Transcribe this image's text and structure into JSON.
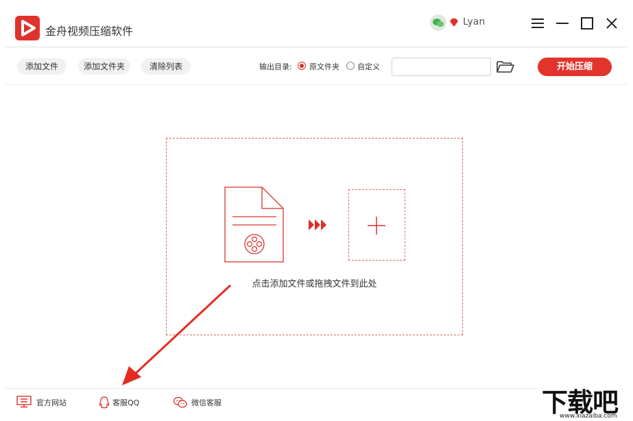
{
  "app": {
    "title": "金舟视频压缩软件",
    "user": "Lyan"
  },
  "toolbar": {
    "add_file": "添加文件",
    "add_folder": "添加文件夹",
    "clear_list": "清除列表",
    "output_label": "输出目录:",
    "option_original": "原文件夹",
    "option_custom": "自定义",
    "selected_option": "原文件夹",
    "path_value": "",
    "start_button": "开始压缩"
  },
  "dropzone": {
    "hint": "点击添加文件或拖拽文件到此处"
  },
  "footer": {
    "website": "官方网站",
    "qq": "客服QQ",
    "wechat": "微信客服"
  },
  "watermark": {
    "big": "下载吧",
    "url": "www.xiazaiba.com"
  },
  "colors": {
    "accent": "#e2342d",
    "dashed_border": "#d56a66"
  }
}
